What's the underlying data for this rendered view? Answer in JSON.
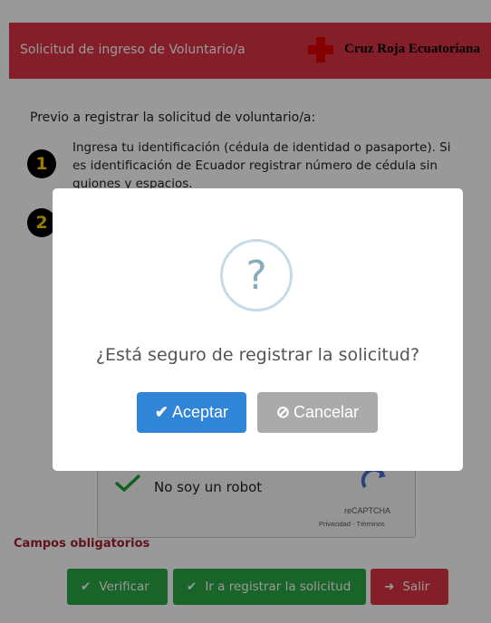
{
  "header": {
    "title": "Solicitud de ingreso de Voluntario/a",
    "brand": "Cruz Roja Ecuatoriana",
    "brand_color": "#dc3545"
  },
  "intro": "Previo a registrar la solicitud de voluntario/a:",
  "steps": [
    {
      "number": "1",
      "text": "Ingresa tu identificación (cédula de identidad o pasaporte). Si es identificación de Ecuador registrar número de cédula sin guiones y espacios."
    },
    {
      "number": "2",
      "text": ""
    }
  ],
  "captcha": {
    "label": "No soy un robot",
    "brand": "reCAPTCHA",
    "links": "Privacidad - Términos"
  },
  "required_note": "Campos obligatorios",
  "actions": {
    "verify_label": "Verificar",
    "register_label": "Ir a registrar la solicitud",
    "exit_label": "Salir"
  },
  "dialog": {
    "icon": "question-icon",
    "message": "¿Está seguro de registrar la solicitud?",
    "confirm_label": "Aceptar",
    "cancel_label": "Cancelar"
  }
}
